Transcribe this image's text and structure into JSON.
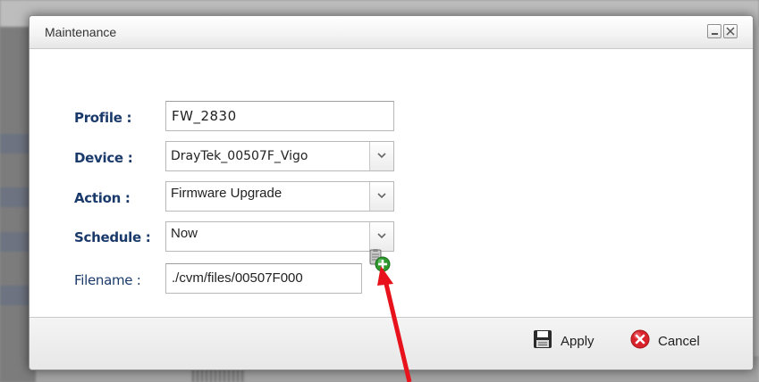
{
  "dialog": {
    "title": "Maintenance",
    "minimize_icon": "minimize-icon",
    "close_icon": "close-icon"
  },
  "form": {
    "profile": {
      "label": "Profile :",
      "value": "FW_2830"
    },
    "device": {
      "label": "Device :",
      "value": "DrayTek_00507F_Vigo"
    },
    "action": {
      "label": "Action :",
      "value": "Firmware Upgrade"
    },
    "schedule": {
      "label": "Schedule :",
      "value": "Now"
    },
    "filename": {
      "label": "Filename :",
      "value": "./cvm/files/00507F000",
      "add_icon": "add-file-icon"
    }
  },
  "footer": {
    "apply_label": "Apply",
    "cancel_label": "Cancel",
    "apply_icon": "save-icon",
    "cancel_icon": "cancel-icon"
  },
  "colors": {
    "label_blue": "#1a3a6b",
    "annotation_red": "#e8121c",
    "cancel_red": "#d8232a",
    "add_green": "#2e9a2e"
  }
}
